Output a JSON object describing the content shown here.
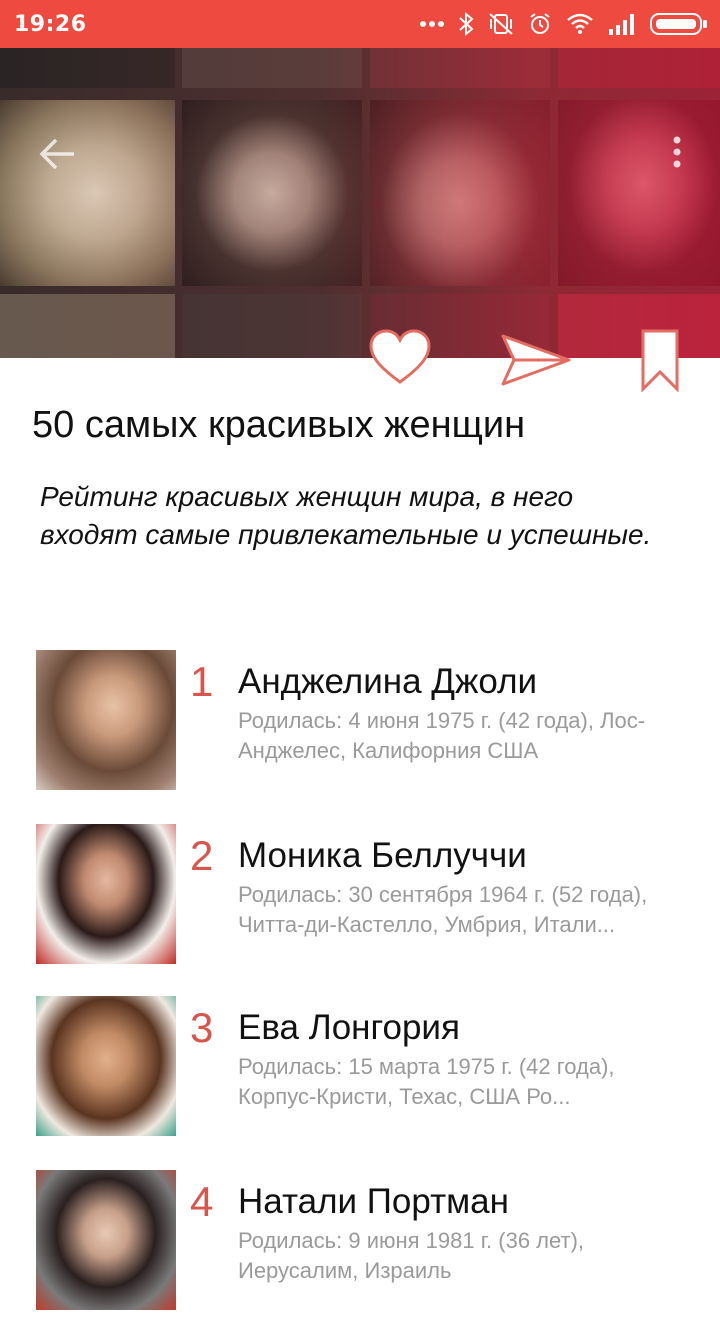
{
  "status_bar": {
    "time": "19:26",
    "icons": [
      "more-dots-icon",
      "bluetooth-icon",
      "vibrate-off-icon",
      "alarm-icon",
      "wifi-icon",
      "signal-icon",
      "battery-icon"
    ]
  },
  "header": {
    "back_icon": "arrow-left-icon",
    "menu_icon": "more-vertical-icon"
  },
  "actions": {
    "like_icon": "heart-outline-icon",
    "share_icon": "send-icon",
    "bookmark_icon": "bookmark-outline-icon"
  },
  "article": {
    "title": "50 самых красивых женщин",
    "subtitle": "Рейтинг красивых женщин мира, в него входят самые привлекательные и успешные."
  },
  "list": [
    {
      "rank": "1",
      "name": "Анджелина Джоли",
      "description": "Родилась: 4 июня 1975 г. (42 года), Лос-Анджелес, Калифорния США"
    },
    {
      "rank": "2",
      "name": "Моника Беллуччи",
      "description": "Родилась: 30 сентября 1964 г. (52 года), Читта-ди-Кастелло, Умбрия, Итали..."
    },
    {
      "rank": "3",
      "name": "Ева Лонгория",
      "description": "Родилась: 15 марта 1975 г. (42 года), Корпус-Кристи, Техас, США Ро..."
    },
    {
      "rank": "4",
      "name": "Натали Портман",
      "description": "Родилась: 9 июня 1981 г. (36 лет), Иерусалим, Израиль"
    }
  ],
  "colors": {
    "status_bar": "#ee4a3f",
    "accent": "#d9544a",
    "secondary_text": "#9a9a9a"
  }
}
